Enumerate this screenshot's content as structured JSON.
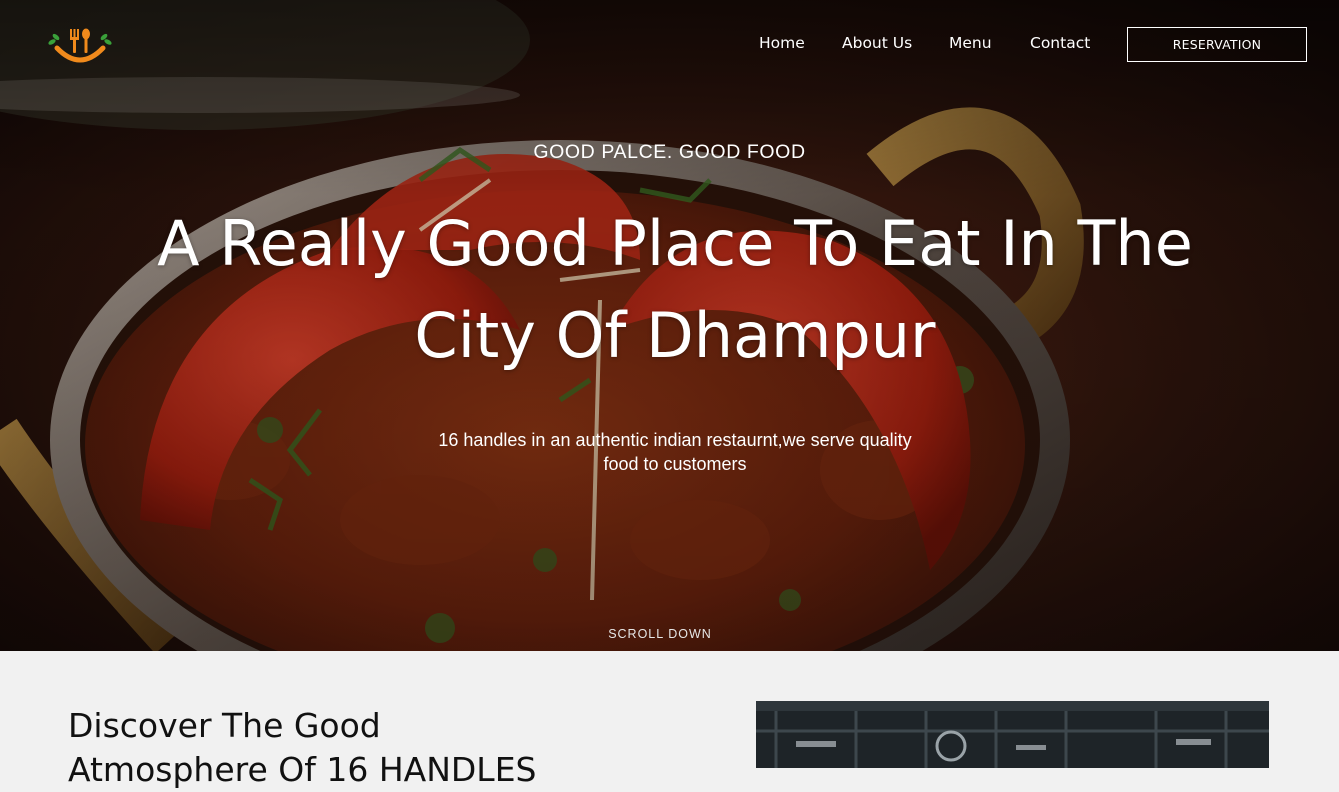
{
  "brand": {
    "logo_icon": "fork-spoon-smile-icon",
    "logo_color": "#f08a1c",
    "leaf_color": "#3aa13a"
  },
  "nav": {
    "items": [
      "Home",
      "About Us",
      "Menu",
      "Contact"
    ],
    "reservation_label": "RESERVATION"
  },
  "hero": {
    "eyebrow": "GOOD PALCE. GOOD FOOD",
    "headline_line1": "A Really Good Place To Eat In The",
    "headline_line2": "City Of Dhampur",
    "subtitle_line1": "16 handles in an authentic indian restaurnt,we serve quality",
    "subtitle_line2": "food to customers",
    "scroll_label": "SCROLL DOWN",
    "background": "curry-dish-photo"
  },
  "about": {
    "heading_line1": "Discover The Good",
    "heading_line2": "Atmosphere Of 16 HANDLES",
    "image": "restaurant-interior-photo"
  },
  "colors": {
    "section_bg": "#f1f1f1",
    "text_dark": "#111111",
    "text_light": "#ffffff"
  }
}
